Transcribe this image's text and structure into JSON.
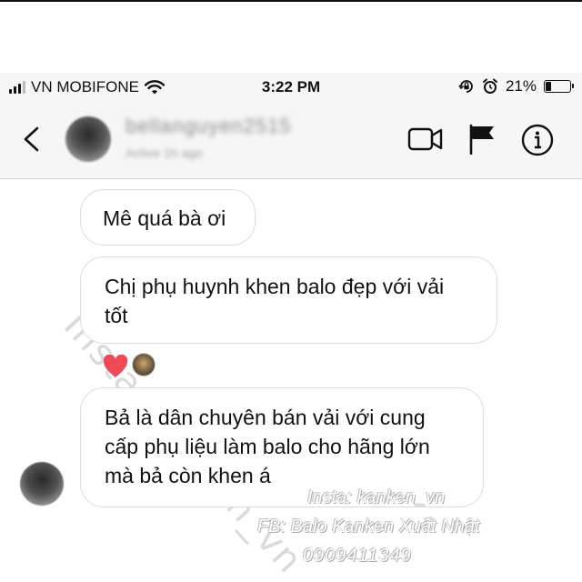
{
  "status_bar": {
    "carrier": "VN MOBIFONE",
    "time": "3:22 PM",
    "battery_percent": "21%",
    "battery_level": 0.21,
    "icons": [
      "signal-icon",
      "wifi-icon",
      "rotation-lock-icon",
      "alarm-icon",
      "battery-icon"
    ]
  },
  "header": {
    "username": "bellanguyen2515",
    "status": "Active 1h ago",
    "icons": [
      "back-chevron-icon",
      "video-call-icon",
      "flag-icon",
      "info-icon"
    ]
  },
  "messages": [
    {
      "text": "Mê quá bà ơi"
    },
    {
      "text": "Chị phụ huynh khen balo đẹp với vải tốt",
      "reactions": [
        "heart-icon",
        "reactor-avatar"
      ]
    },
    {
      "text": "Bả là dân chuyên bán vải với cung cấp phụ liệu làm balo cho hãng lớn mà bả còn khen á"
    }
  ],
  "watermark": {
    "diagonal": "Insta: kanken_vn",
    "line1": "Insta: kanken_vn",
    "line2": "FB: Balo Kanken Xuất Nhật",
    "line3": "0909411349"
  },
  "colors": {
    "bar_background": "#f6f6f6",
    "bubble_border": "#dcdcdc",
    "heart": "#ed4956"
  }
}
